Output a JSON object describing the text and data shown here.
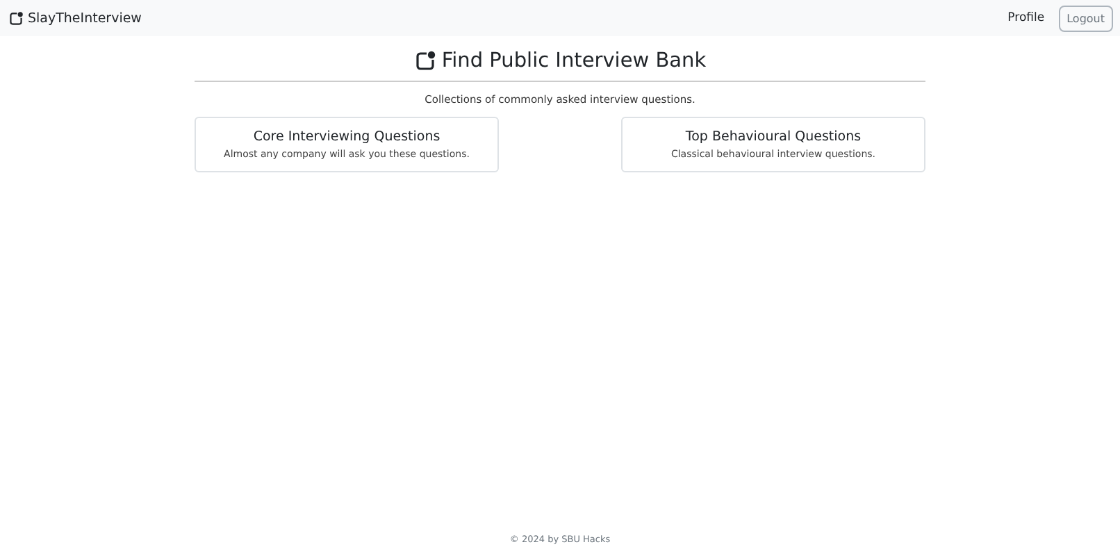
{
  "navbar": {
    "brand": "SlayTheInterview",
    "links": [
      "Profile"
    ],
    "logout_button": "Logout"
  },
  "header": {
    "title": "Find Public Interview Bank",
    "subtitle": "Collections of commonly asked interview questions."
  },
  "banks": [
    {
      "title": "Core Interviewing Questions",
      "description": "Almost any company will ask you these questions."
    },
    {
      "title": "Top Behavioural Questions",
      "description": "Classical behavioural interview questions."
    }
  ],
  "footer": "© 2024 by SBU Hacks"
}
